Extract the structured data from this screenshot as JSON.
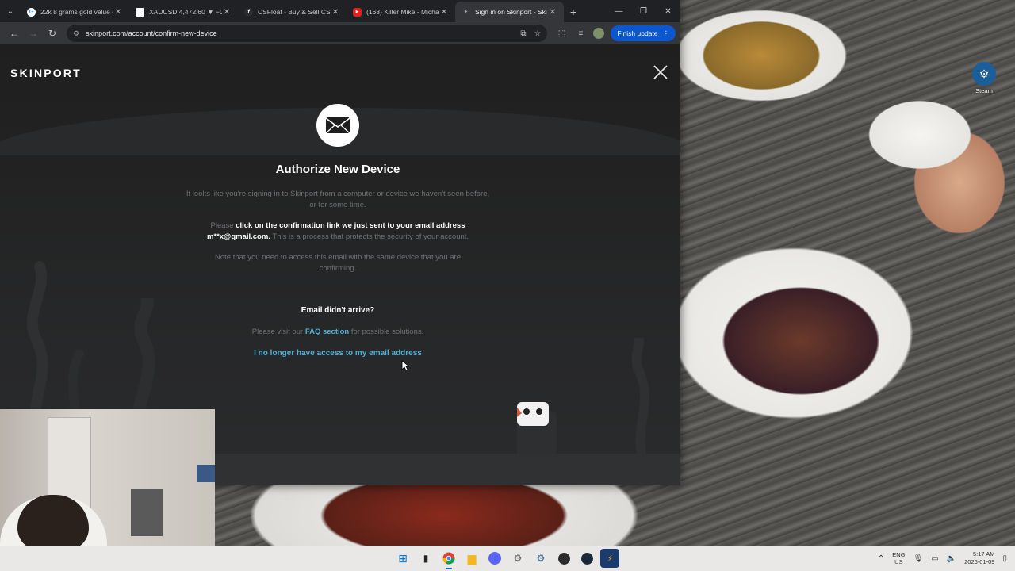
{
  "browser": {
    "tabs": [
      {
        "title": "22k 8 grams gold value c",
        "icon": "google-icon",
        "active": false
      },
      {
        "title": "XAUUSD 4,472.60 ▼ −0.",
        "icon": "tradingview-icon",
        "active": false
      },
      {
        "title": "CSFloat - Buy & Sell CS2",
        "icon": "csfloat-icon",
        "active": false
      },
      {
        "title": "(168) Killer Mike - Micha",
        "icon": "youtube-icon",
        "active": false
      },
      {
        "title": "Sign in on Skinport - Ski",
        "icon": "skinport-icon",
        "active": true
      }
    ],
    "new_tab": "+",
    "url": "skinport.com/account/confirm-new-device",
    "finish_update": "Finish update"
  },
  "page": {
    "logo": "SKINPORT",
    "title": "Authorize New Device",
    "para1": "It looks like you're signing in to Skinport from a computer or device we haven't seen before, or for some time.",
    "para2_pre": "Please ",
    "para2_bold": "click on the confirmation link we just sent to your email address m**x@gmail.com.",
    "para2_post": " This is a process that protects the security of your account.",
    "para3": "Note that you need to access this email with the same device that you are confirming.",
    "didnt_arrive": "Email didn't arrive?",
    "faq_pre": "Please visit our ",
    "faq_link": "FAQ section",
    "faq_post": " for possible solutions.",
    "no_access": "I no longer have access to my email address"
  },
  "desktop": {
    "steam_label": "Steam"
  },
  "taskbar": {
    "lang_line1": "ENG",
    "lang_line2": "US",
    "time": "5:17 AM",
    "date": "2026-01-09"
  },
  "colors": {
    "accent_link": "#4fb0d8",
    "finish_update_bg": "#0b57d0"
  }
}
